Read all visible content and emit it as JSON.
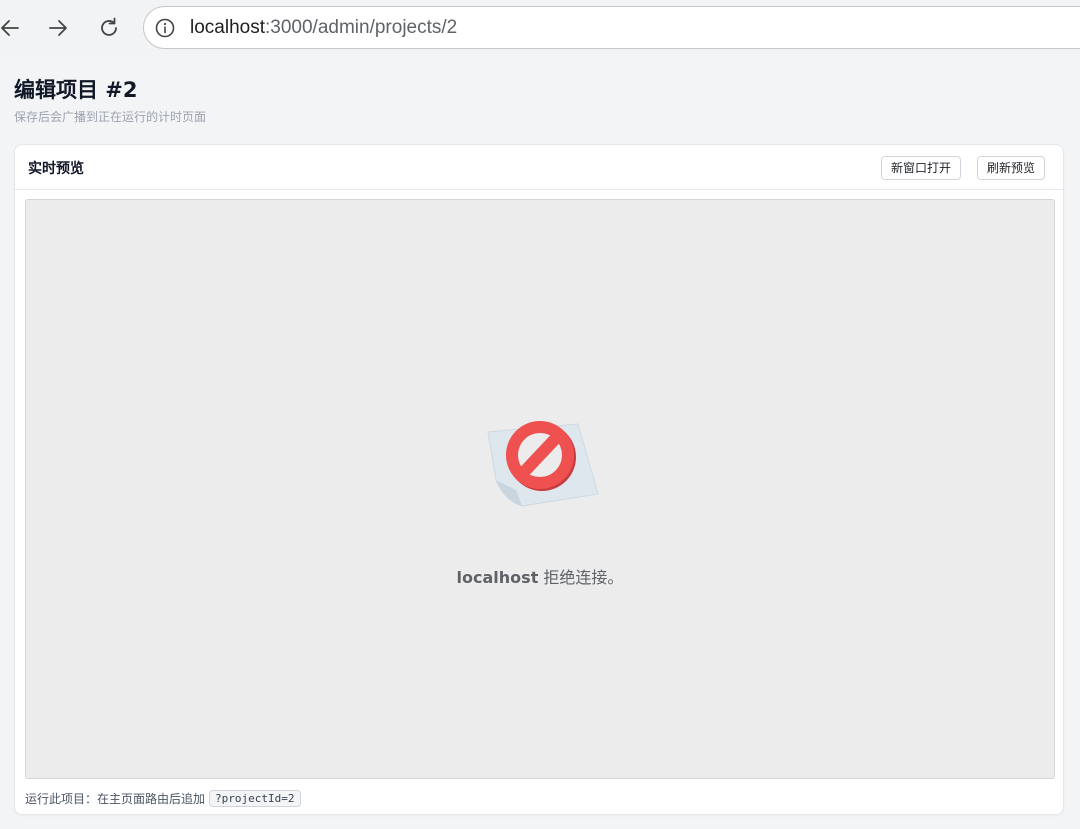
{
  "browser": {
    "url_host": "localhost",
    "url_path": ":3000/admin/projects/2",
    "icons": [
      "back-arrow-icon",
      "forward-arrow-icon",
      "reload-icon",
      "info-icon"
    ]
  },
  "page": {
    "title": "编辑项目 #2",
    "subtitle": "保存后会广播到正在运行的计时页面"
  },
  "preview_card": {
    "title": "实时预览",
    "open_new_window_label": "新窗口打开",
    "refresh_label": "刷新预览",
    "error": {
      "host": "localhost",
      "message": " 拒绝连接。",
      "icon": "blocked-connection-icon",
      "accent_color": "#e5484d"
    },
    "footer": {
      "hint": "运行此项目：在主页面路由后追加",
      "param": "?projectId=2"
    }
  }
}
